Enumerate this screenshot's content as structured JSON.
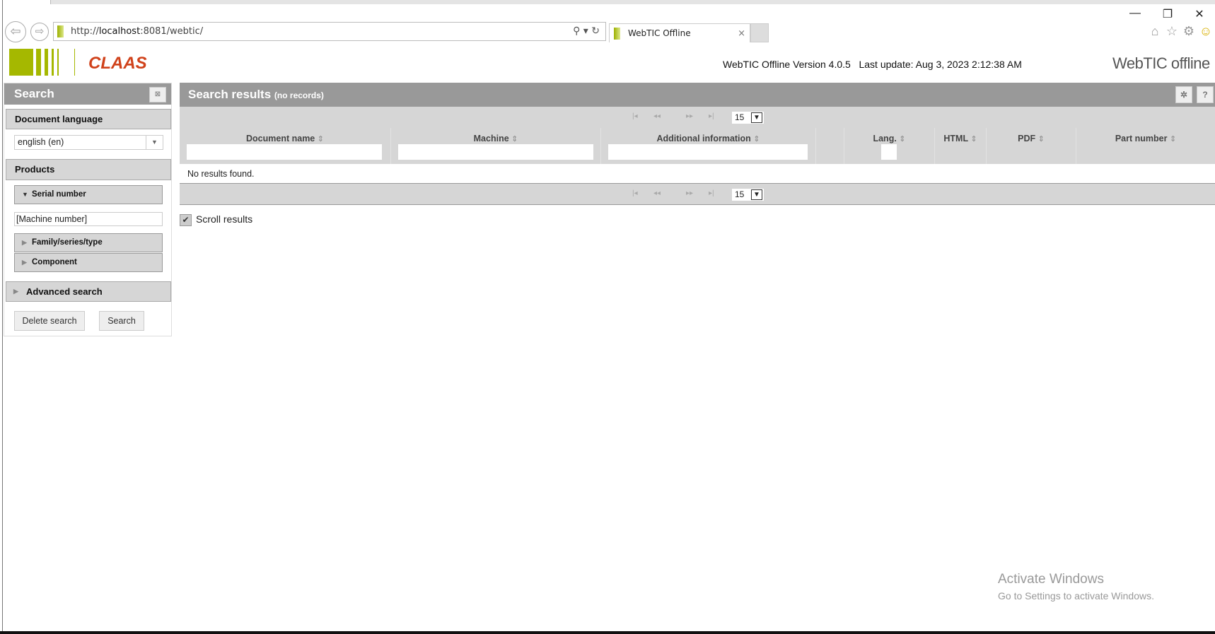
{
  "browser": {
    "url_prefix": "http://",
    "url_host": "localhost",
    "url_rest": ":8081/webtic/",
    "tab_title": "WebTIC Offline",
    "tab_close": "×",
    "back": "⇦",
    "forward": "⇨",
    "addr_icons": "⚲ ▾ ↻",
    "min": "—",
    "restore": "❐",
    "close": "✕",
    "home": "⌂",
    "star": "☆",
    "gear": "⚙",
    "smiley": "☺"
  },
  "header": {
    "logo_text": "CLAAS",
    "version": "WebTIC Offline Version 4.0.5",
    "last_update": "Last update: Aug 3, 2023 2:12:38 AM",
    "brand": "WebTIC offline"
  },
  "search_panel": {
    "title": "Search",
    "collapse": "⊠",
    "doc_language_label": "Document language",
    "doc_language_value": "english (en)",
    "products_label": "Products",
    "serial_number_label": "Serial number",
    "machine_number_value": "[Machine number]",
    "family_label": "Family/series/type",
    "component_label": "Component",
    "advanced_label": "Advanced search",
    "delete_button": "Delete search",
    "search_button": "Search"
  },
  "results": {
    "title": "Search results",
    "subtitle": "(no records)",
    "settings": "✲",
    "help": "?",
    "page_size": "15",
    "pager_first": "|◂",
    "pager_prev": "◂◂",
    "pager_next": "▸▸",
    "pager_last": "▸|",
    "columns": [
      "Document name",
      "Machine",
      "Additional information",
      "",
      "Lang.",
      "HTML",
      "PDF",
      "Part number"
    ],
    "sort_icon": "⇕",
    "empty_message": "No results found.",
    "scroll_results_label": "Scroll results",
    "scroll_results_checked": true
  },
  "watermark": {
    "line1": "Activate Windows",
    "line2": "Go to Settings to activate Windows."
  },
  "colors": {
    "brand_green": "#a5b800",
    "claas_red": "#d0421b",
    "panel_header": "#999999",
    "panel_bg": "#d6d6d6"
  }
}
